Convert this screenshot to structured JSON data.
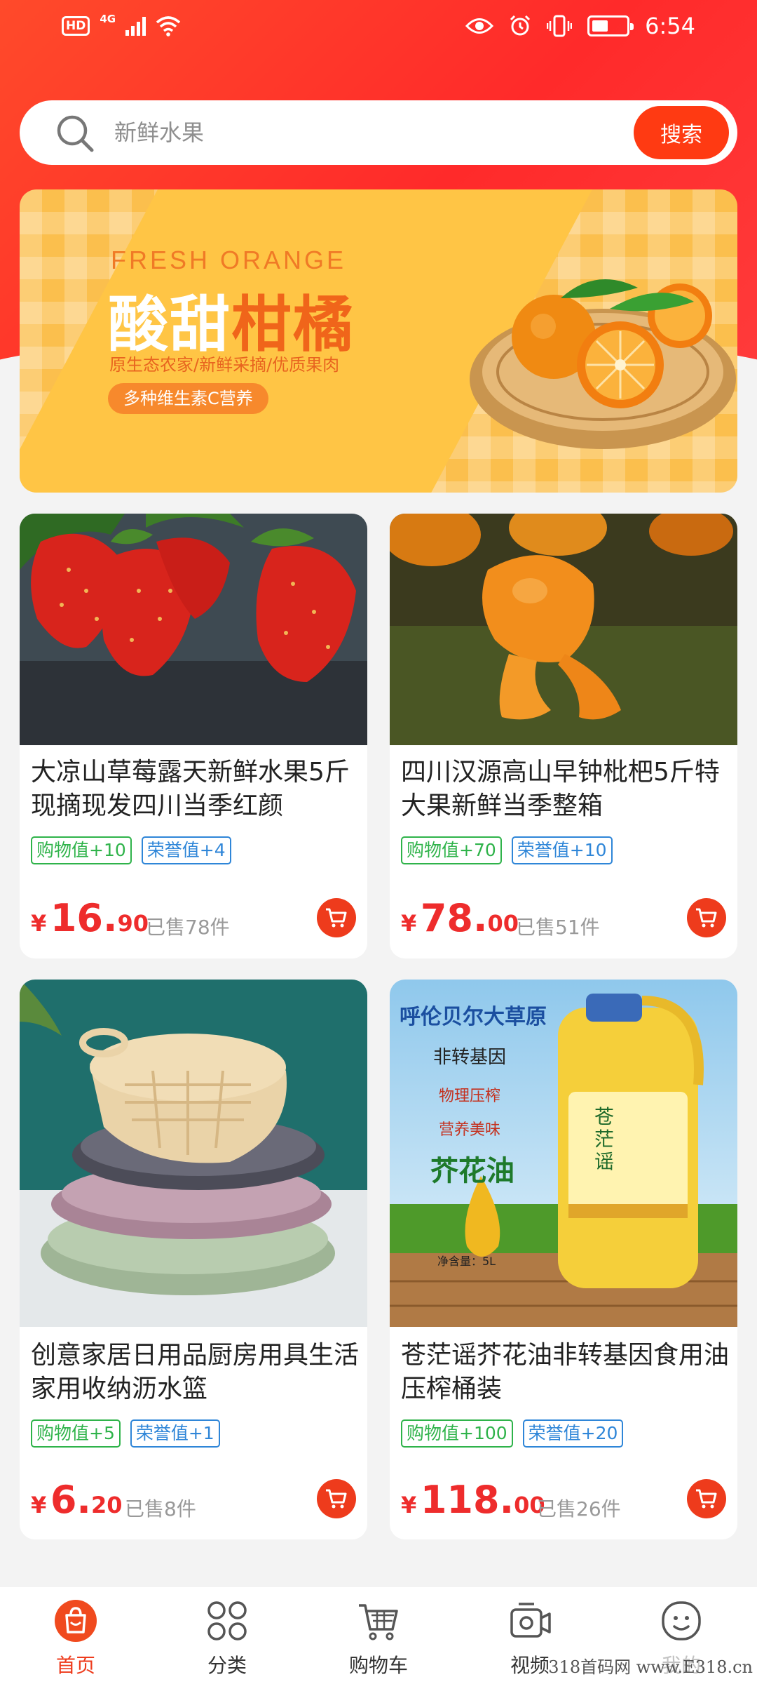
{
  "status_bar": {
    "hd": "HD",
    "network": "4G",
    "time": "6:54"
  },
  "search": {
    "placeholder": "新鲜水果",
    "button_label": "搜索"
  },
  "banner": {
    "english": "FRESH ORANGE",
    "title_part1": "酸甜",
    "title_part2": "柑橘",
    "subtitle": "原生态农家/新鲜采摘/优质果肉",
    "pill": "多种维生素C营养"
  },
  "products": [
    {
      "title": "大凉山草莓露天新鲜水果5斤现摘现发四川当季红颜",
      "tag_shopping": "购物值+10",
      "tag_honor": "荣誉值+4",
      "price_symbol": "¥",
      "price_int": "16.",
      "price_dec": "90",
      "sold": "已售78件"
    },
    {
      "title": "四川汉源高山早钟枇杷5斤特大果新鲜当季整箱",
      "tag_shopping": "购物值+70",
      "tag_honor": "荣誉值+10",
      "price_symbol": "¥",
      "price_int": "78.",
      "price_dec": "00",
      "sold": "已售51件"
    },
    {
      "title": "创意家居日用品厨房用具生活家用收纳沥水篮",
      "tag_shopping": "购物值+5",
      "tag_honor": "荣誉值+1",
      "price_symbol": "¥",
      "price_int": "6.",
      "price_dec": "20",
      "sold": "已售8件"
    },
    {
      "title": "苍茫谣芥花油非转基因食用油压榨桶装",
      "tag_shopping": "购物值+100",
      "tag_honor": "荣誉值+20",
      "price_symbol": "¥",
      "price_int": "118.",
      "price_dec": "00",
      "sold": "已售26件",
      "image_text": {
        "line1": "呼伦贝尔大草原",
        "line2": "非转基因",
        "line3": "物理压榨",
        "line4": "营养美味",
        "line5": "芥花油",
        "volume": "净含量：5L",
        "bottle_label": "苍茫谣"
      }
    }
  ],
  "bottom_nav": [
    {
      "label": "首页",
      "icon": "home-bag-icon",
      "active": true
    },
    {
      "label": "分类",
      "icon": "category-grid-icon",
      "active": false
    },
    {
      "label": "购物车",
      "icon": "shopping-cart-icon",
      "active": false
    },
    {
      "label": "视频",
      "icon": "video-icon",
      "active": false
    },
    {
      "label": "我的",
      "icon": "profile-face-icon",
      "active": false
    }
  ],
  "watermark": "318首码网 www.E318.cn",
  "colors": {
    "brand_red": "#ff3a12",
    "price_red": "#ee2c2c",
    "tag_green": "#2fb34a",
    "tag_blue": "#2f86d8",
    "banner_yellow": "#fbbf4d"
  }
}
